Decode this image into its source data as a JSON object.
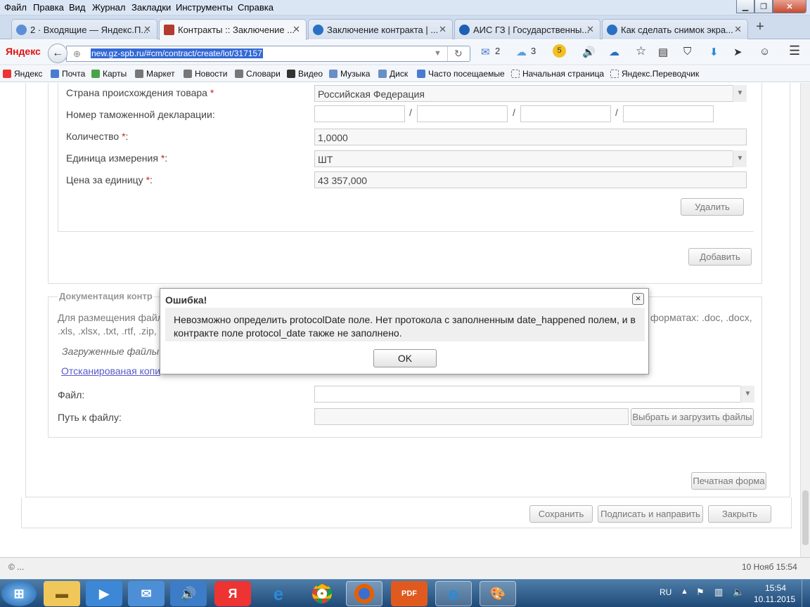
{
  "menu": [
    "Файл",
    "Правка",
    "Вид",
    "Журнал",
    "Закладки",
    "Инструменты",
    "Справка"
  ],
  "tabs": [
    {
      "label": "2 · Входящие — Яндекс.П...",
      "color": "#5b8fd6"
    },
    {
      "label": "Контракты :: Заключение ...",
      "color": "#b33b2e"
    },
    {
      "label": "Заключение контракта | ...",
      "color": "#2a70c4"
    },
    {
      "label": "АИС ГЗ | Государственны...",
      "color": "#1e5fb3"
    },
    {
      "label": "Как сделать снимок экра...",
      "color": "#2a70c4"
    }
  ],
  "newtab": "+",
  "nav": {
    "brand": "Яндекс",
    "url": "new.gz-spb.ru/#cm/contract/create/lot/317157",
    "mail_count": "2",
    "weather": "3",
    "badge": "5"
  },
  "bookmarks": [
    "Яндекс",
    "Почта",
    "Карты",
    "Маркет",
    "Новости",
    "Словари",
    "Видео",
    "Музыка",
    "Диск",
    "Часто посещаемые",
    "Начальная страница",
    "Яндекс.Переводчик"
  ],
  "form": {
    "country_label": "Страна происхождения товара",
    "country_value": "Российская Федерация",
    "customs_label": "Номер таможенной декларации:",
    "qty_label": "Количество",
    "qty_value": "1,0000",
    "unit_label": "Единица измерения",
    "unit_value": "ШТ",
    "price_label": "Цена за единицу",
    "price_value": "43 357,000",
    "req": "*",
    "colon": ":",
    "slash": "/",
    "delete_btn": "Удалить",
    "add_btn": "Добавить"
  },
  "docs": {
    "section_title": "Документация контр",
    "text_left": "Для размещения файл",
    "text_right": "форматах: .doc, .docx,",
    "text_line2": ".xls, .xlsx, .txt, .rtf, .zip,",
    "uploaded_label": "Загруженные файлы",
    "scan_link": "Отсканированая копи",
    "file_label": "Файл:",
    "path_label": "Путь к файлу:",
    "upload_btn": "Выбрать и загрузить файлы",
    "print_btn": "Печатная форма"
  },
  "actions": {
    "save": "Сохранить",
    "sign": "Подписать и направить",
    "close": "Закрыть"
  },
  "status": {
    "left": "© ...",
    "right": "10 Нояб 15:54"
  },
  "dialog": {
    "title": "Ошибка!",
    "message": "Невозможно определить protocolDate поле. Нет протокола с заполненным date_happened полем, и в контракте поле protocol_date также не заполнено.",
    "ok": "OK",
    "close": "×"
  },
  "tray": {
    "lang": "RU",
    "time": "15:54",
    "date": "10.11.2015"
  }
}
